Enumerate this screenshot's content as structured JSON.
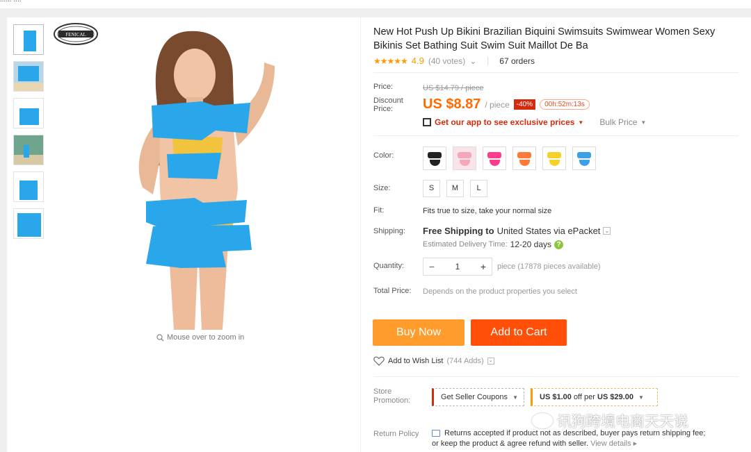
{
  "top_strip_text": "...... ....",
  "gallery": {
    "zoom_hint": "Mouse over to zoom in",
    "logo_text": "FENICAL"
  },
  "product": {
    "title": "New Hot Push Up Bikini Brazilian Biquini Swimsuits Swimwear Women Sexy Bikinis Set Bathing Suit Swim Suit Maillot De Ba",
    "stars": "★★★★★",
    "rating": "4.9",
    "votes": "(40 votes)",
    "orders": "67 orders"
  },
  "pricing": {
    "price_label": "Price:",
    "original_price": "US $14.79 / piece",
    "discount_label": "Discount Price:",
    "discount_price": "US $8.87",
    "unit": "/ piece",
    "percent_off": "-40%",
    "timer": "00h:52m:13s",
    "app_link": "Get our app to see exclusive prices",
    "bulk_price": "Bulk Price"
  },
  "options": {
    "color_label": "Color:",
    "colors": [
      "#222222",
      "#f3a7b8",
      "#ff3b8d",
      "#ff7a3a",
      "#f5d22a",
      "#3aa0e8"
    ],
    "size_label": "Size:",
    "sizes": [
      "S",
      "M",
      "L"
    ],
    "fit_label": "Fit:",
    "fit_text": "Fits true to size, take your normal size",
    "shipping_label": "Shipping:",
    "shipping_free": "Free Shipping to",
    "shipping_dest": "United States via ePacket",
    "eta_label": "Estimated Delivery Time:",
    "eta_value": "12-20 days",
    "quantity_label": "Quantity:",
    "quantity": "1",
    "available": "piece (17878 pieces available)",
    "total_label": "Total Price:",
    "total_text": "Depends on the product properties you select"
  },
  "actions": {
    "buy_now": "Buy Now",
    "add_to_cart": "Add to Cart",
    "wish_label": "Add to Wish List",
    "wish_count": "(744 Adds)"
  },
  "store": {
    "promo_label": "Store Promotion:",
    "coupon_label": "Get Seller Coupons",
    "promo_offer_prefix": "US $1.00",
    "promo_offer_mid": "off per",
    "promo_offer_amount": "US $29.00",
    "return_label": "Return Policy",
    "return_line1": "Returns accepted if product not as described, buyer pays return shipping fee;",
    "return_line2": "or keep the product & agree refund with seller.",
    "view_details": "View details ▸"
  },
  "watermark": "讯狗跨境电商天天说",
  "colors": {
    "accent_orange": "#ff6a00",
    "buy_now": "#ff9c2b",
    "add_to_cart": "#ff4f08",
    "discount_red": "#d42b0e",
    "star": "#ff9a00",
    "censor_blue": "#29a7ea"
  }
}
